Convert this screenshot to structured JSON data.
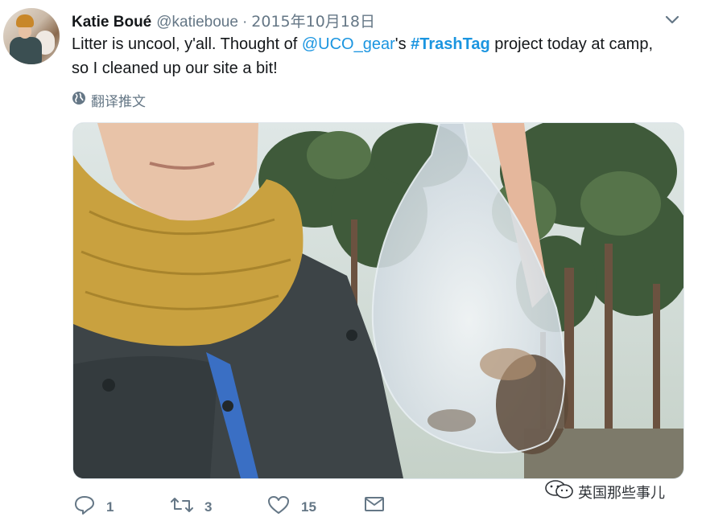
{
  "tweet": {
    "author_name": "Katie Boué",
    "author_handle": "@katieboue",
    "separator": "·",
    "date": "2015年10月18日",
    "text_part1": "Litter is uncool, y'all. Thought of ",
    "mention": "@UCO_gear",
    "text_part2": "'s ",
    "hashtag": "#TrashTag",
    "text_part3": " project today at camp,",
    "text_line2": "so I cleaned up our site a bit!",
    "translate_label": "翻译推文"
  },
  "actions": {
    "reply_count": "1",
    "retweet_count": "3",
    "like_count": "15"
  },
  "watermark": {
    "text": "英国那些事儿"
  },
  "icons": {
    "menu": "chevron-down-icon",
    "translate": "globe-icon",
    "reply": "reply-icon",
    "retweet": "retweet-icon",
    "like": "heart-icon",
    "dm": "envelope-icon",
    "watermark": "wechat-icon"
  },
  "colors": {
    "link": "#1b95e0",
    "muted": "#657786",
    "text": "#14171a"
  }
}
